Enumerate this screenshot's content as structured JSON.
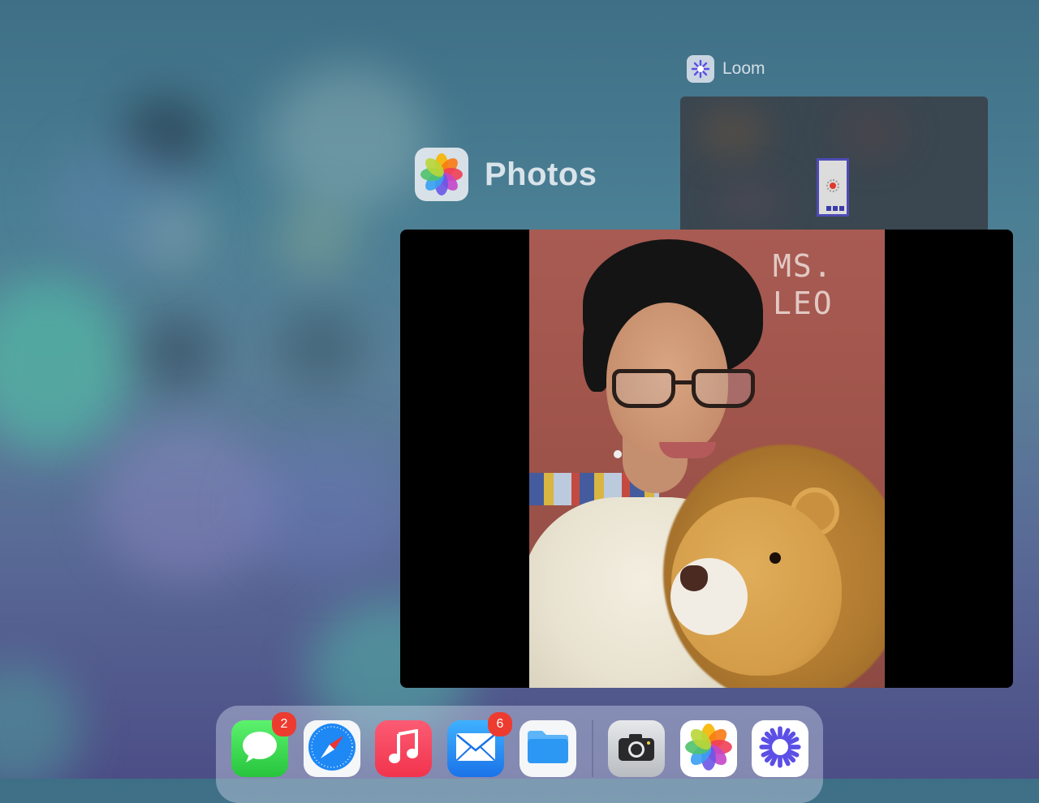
{
  "switcher": {
    "loom_card": {
      "app_name": "Loom"
    },
    "photos_card": {
      "app_name": "Photos",
      "photo_text": "MS.\nLEO"
    }
  },
  "dock": {
    "apps": [
      {
        "name": "Messages",
        "badge": "2"
      },
      {
        "name": "Safari"
      },
      {
        "name": "Music"
      },
      {
        "name": "Mail",
        "badge": "6"
      },
      {
        "name": "Files"
      },
      {
        "name": "Camera"
      },
      {
        "name": "Photos"
      },
      {
        "name": "Loom"
      }
    ]
  },
  "colors": {
    "badge": "#ee3b30",
    "loom_brand": "#4e4bb3",
    "messages_green": "#27c43d",
    "music_red": "#f2334d",
    "mail_blue": "#1a73e8"
  },
  "icons": [
    "messages-icon",
    "safari-icon",
    "music-icon",
    "mail-icon",
    "files-icon",
    "camera-icon",
    "photos-icon",
    "loom-icon"
  ]
}
